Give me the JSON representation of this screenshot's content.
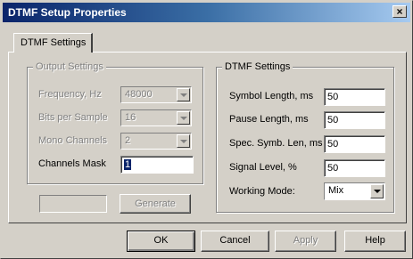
{
  "window": {
    "title": "DTMF Setup Properties",
    "close_glyph": "×"
  },
  "tab": {
    "label": "DTMF Settings"
  },
  "output_settings": {
    "title": "Output Settings",
    "frequency": {
      "label": "Frequency, Hz",
      "value": "48000"
    },
    "bits": {
      "label": "Bits per Sample",
      "value": "16"
    },
    "mono": {
      "label": "Mono Channels",
      "value": "2"
    },
    "mask": {
      "label": "Channels Mask",
      "value": "1"
    },
    "generate_label": "Generate"
  },
  "dtmf_settings": {
    "title": "DTMF Settings",
    "symbol_length": {
      "label": "Symbol Length, ms",
      "value": "50"
    },
    "pause_length": {
      "label": "Pause Length, ms",
      "value": "50"
    },
    "spec_symb_len": {
      "label": "Spec. Symb. Len, ms",
      "value": "50"
    },
    "signal_level": {
      "label": "Signal Level, %",
      "value": "50"
    },
    "working_mode": {
      "label": "Working Mode:",
      "value": "Mix"
    }
  },
  "buttons": {
    "ok": "OK",
    "cancel": "Cancel",
    "apply": "Apply",
    "help": "Help"
  }
}
